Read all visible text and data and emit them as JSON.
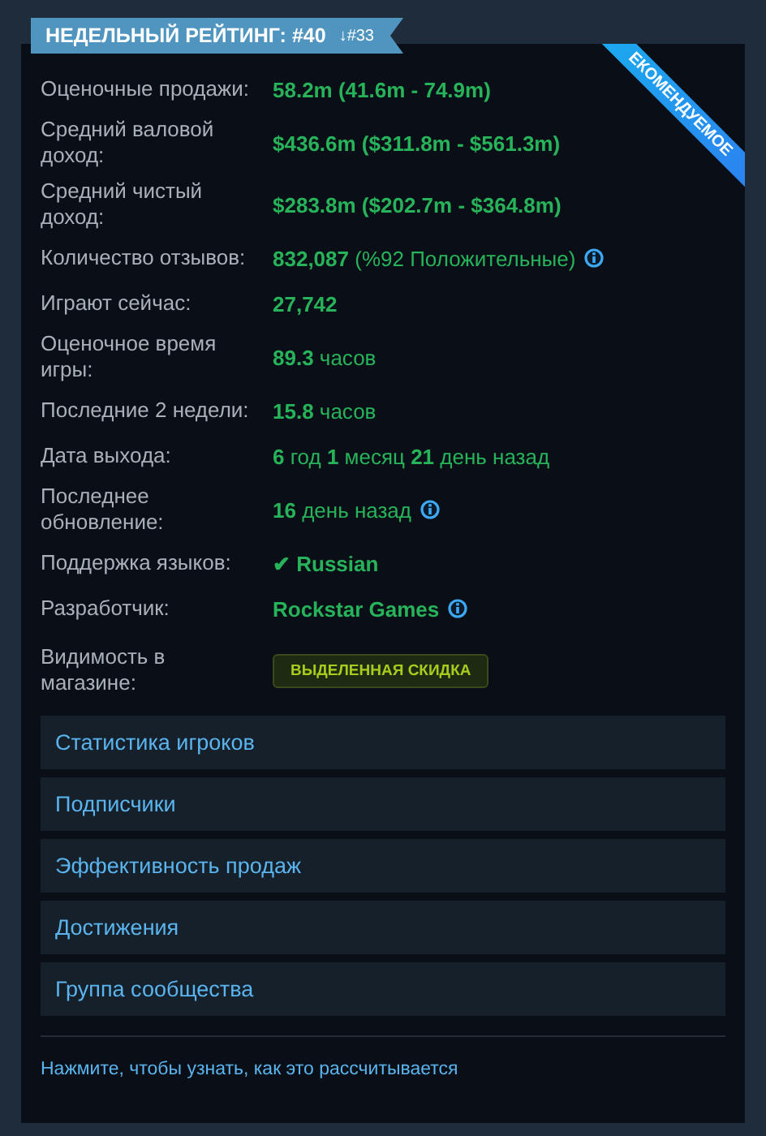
{
  "rank_banner": {
    "title": "НЕДЕЛЬНЫЙ РЕЙТИНГ: #40",
    "change": "↓#33"
  },
  "corner_ribbon": {
    "text": "ЕКОМЕНДУЕМОЕ"
  },
  "stats": [
    {
      "kind": "text",
      "label": "Оценочные продажи:",
      "value": "**58.2m (41.6m - 74.9m)**",
      "info": false
    },
    {
      "kind": "text",
      "label": "Средний валовой доход:",
      "value": "**$436.6m ($311.8m - $561.3m)**",
      "info": false
    },
    {
      "kind": "text",
      "label": "Средний чистый доход:",
      "value": "**$283.8m ($202.7m - $364.8m)**",
      "info": false
    },
    {
      "kind": "text",
      "label": "Количество отзывов:",
      "value": "**832,087** (%92 Положительные)",
      "info": true
    },
    {
      "kind": "text",
      "label": "Играют сейчас:",
      "value": "**27,742**",
      "info": false
    },
    {
      "kind": "text",
      "label": "Оценочное время игры:",
      "value": "**89.3** часов",
      "info": false
    },
    {
      "kind": "text",
      "label": "Последние 2 недели:",
      "value": "**15.8** часов",
      "info": false
    },
    {
      "kind": "text",
      "label": "Дата выхода:",
      "value": "**6** год **1** месяц **21** день назад",
      "info": false
    },
    {
      "kind": "text",
      "label": "Последнее обновление:",
      "value": "**16** день назад",
      "info": true
    },
    {
      "kind": "text",
      "label": "Поддержка языков:",
      "value": "**✔ Russian**",
      "info": false
    },
    {
      "kind": "text",
      "label": "Разработчик:",
      "value": "**Rockstar Games**",
      "info": true
    },
    {
      "kind": "badge",
      "label": "Видимость в магазине:",
      "value": "ВЫДЕЛЕННАЯ СКИДКА",
      "info": false
    }
  ],
  "links": [
    "Статистика игроков",
    "Подписчики",
    "Эффективность продаж",
    "Достижения",
    "Группа сообщества"
  ],
  "footer_link": "Нажмите, чтобы узнать, как это рассчитывается"
}
